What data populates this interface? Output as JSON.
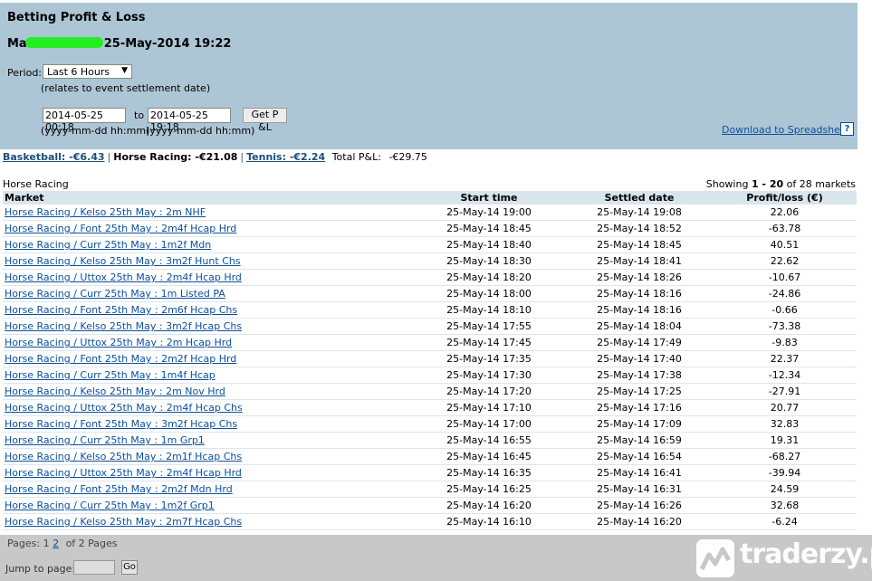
{
  "header": {
    "title": "Betting Profit & Loss",
    "user_prefix": "Ma",
    "user_datetime": "25-May-2014 19:22"
  },
  "filters": {
    "period_label": "Period:",
    "period_value": "Last 6 Hours",
    "relates_note": "(relates to event settlement date)",
    "from_value": "2014-05-25 00:18",
    "to_label": "to",
    "to_value": "2014-05-25 19:18",
    "get_button": "Get P &L",
    "format_hint_from": "(yyyy-mm-dd hh:mm)",
    "format_hint_to": "(yyyy-mm-dd hh:mm)",
    "download_link": "Download to Spreadsheet",
    "help_glyph": "?"
  },
  "summary": {
    "basketball": "Basketball: -€6.43",
    "horse_racing": "Horse Racing: -€21.08",
    "tennis": "Tennis: -€2.24",
    "total_label": "Total P&L:",
    "total_value": "-€29.75"
  },
  "section": {
    "title": "Horse Racing",
    "showing_prefix": "Showing",
    "showing_range": "1 - 20",
    "showing_suffix": "of 28 markets"
  },
  "table": {
    "headers": [
      "Market",
      "Start time",
      "Settled date",
      "Profit/loss (€)"
    ],
    "rows": [
      {
        "market": "Horse Racing / Kelso 25th May : 2m NHF",
        "start": "25-May-14 19:00",
        "settled": "25-May-14 19:08",
        "pl": "22.06"
      },
      {
        "market": "Horse Racing / Font 25th May : 2m4f Hcap Hrd",
        "start": "25-May-14 18:45",
        "settled": "25-May-14 18:52",
        "pl": "-63.78"
      },
      {
        "market": "Horse Racing / Curr 25th May : 1m2f Mdn",
        "start": "25-May-14 18:40",
        "settled": "25-May-14 18:45",
        "pl": "40.51"
      },
      {
        "market": "Horse Racing / Kelso 25th May : 3m2f Hunt Chs",
        "start": "25-May-14 18:30",
        "settled": "25-May-14 18:41",
        "pl": "22.62"
      },
      {
        "market": "Horse Racing / Uttox 25th May : 2m4f Hcap Hrd",
        "start": "25-May-14 18:20",
        "settled": "25-May-14 18:26",
        "pl": "-10.67"
      },
      {
        "market": "Horse Racing / Curr 25th May : 1m Listed PA",
        "start": "25-May-14 18:00",
        "settled": "25-May-14 18:16",
        "pl": "-24.86"
      },
      {
        "market": "Horse Racing / Font 25th May : 2m6f Hcap Chs",
        "start": "25-May-14 18:10",
        "settled": "25-May-14 18:16",
        "pl": "-0.66"
      },
      {
        "market": "Horse Racing / Kelso 25th May : 3m2f Hcap Chs",
        "start": "25-May-14 17:55",
        "settled": "25-May-14 18:04",
        "pl": "-73.38"
      },
      {
        "market": "Horse Racing / Uttox 25th May : 2m Hcap Hrd",
        "start": "25-May-14 17:45",
        "settled": "25-May-14 17:49",
        "pl": "-9.83"
      },
      {
        "market": "Horse Racing / Font 25th May : 2m2f Hcap Hrd",
        "start": "25-May-14 17:35",
        "settled": "25-May-14 17:40",
        "pl": "22.37"
      },
      {
        "market": "Horse Racing / Curr 25th May : 1m4f Hcap",
        "start": "25-May-14 17:30",
        "settled": "25-May-14 17:38",
        "pl": "-12.34"
      },
      {
        "market": "Horse Racing / Kelso 25th May : 2m Nov Hrd",
        "start": "25-May-14 17:20",
        "settled": "25-May-14 17:25",
        "pl": "-27.91"
      },
      {
        "market": "Horse Racing / Uttox 25th May : 2m4f Hcap Chs",
        "start": "25-May-14 17:10",
        "settled": "25-May-14 17:16",
        "pl": "20.77"
      },
      {
        "market": "Horse Racing / Font 25th May : 3m2f Hcap Chs",
        "start": "25-May-14 17:00",
        "settled": "25-May-14 17:09",
        "pl": "32.83"
      },
      {
        "market": "Horse Racing / Curr 25th May : 1m Grp1",
        "start": "25-May-14 16:55",
        "settled": "25-May-14 16:59",
        "pl": "19.31"
      },
      {
        "market": "Horse Racing / Kelso 25th May : 2m1f Hcap Chs",
        "start": "25-May-14 16:45",
        "settled": "25-May-14 16:54",
        "pl": "-68.27"
      },
      {
        "market": "Horse Racing / Uttox 25th May : 2m4f Hcap Hrd",
        "start": "25-May-14 16:35",
        "settled": "25-May-14 16:41",
        "pl": "-39.94"
      },
      {
        "market": "Horse Racing / Font 25th May : 2m2f Mdn Hrd",
        "start": "25-May-14 16:25",
        "settled": "25-May-14 16:31",
        "pl": "24.59"
      },
      {
        "market": "Horse Racing / Curr 25th May : 1m2f Grp1",
        "start": "25-May-14 16:20",
        "settled": "25-May-14 16:26",
        "pl": "32.68"
      },
      {
        "market": "Horse Racing / Kelso 25th May : 2m7f Hcap Chs",
        "start": "25-May-14 16:10",
        "settled": "25-May-14 16:20",
        "pl": "-6.24"
      }
    ]
  },
  "pagination": {
    "label": "Pages:",
    "pages": [
      "1",
      "2"
    ],
    "total": "of 2 Pages",
    "jump_label": "Jump to page:",
    "go_button": "Go"
  },
  "watermark": {
    "text": "traderzy.pl",
    "logo_icon": "traderzy-logo-icon"
  },
  "colors": {
    "header_bg": "#adc6d6",
    "table_header_bg": "#d9e5ec",
    "link": "#0b4f9b",
    "footer_bg": "#c8c8c8"
  }
}
